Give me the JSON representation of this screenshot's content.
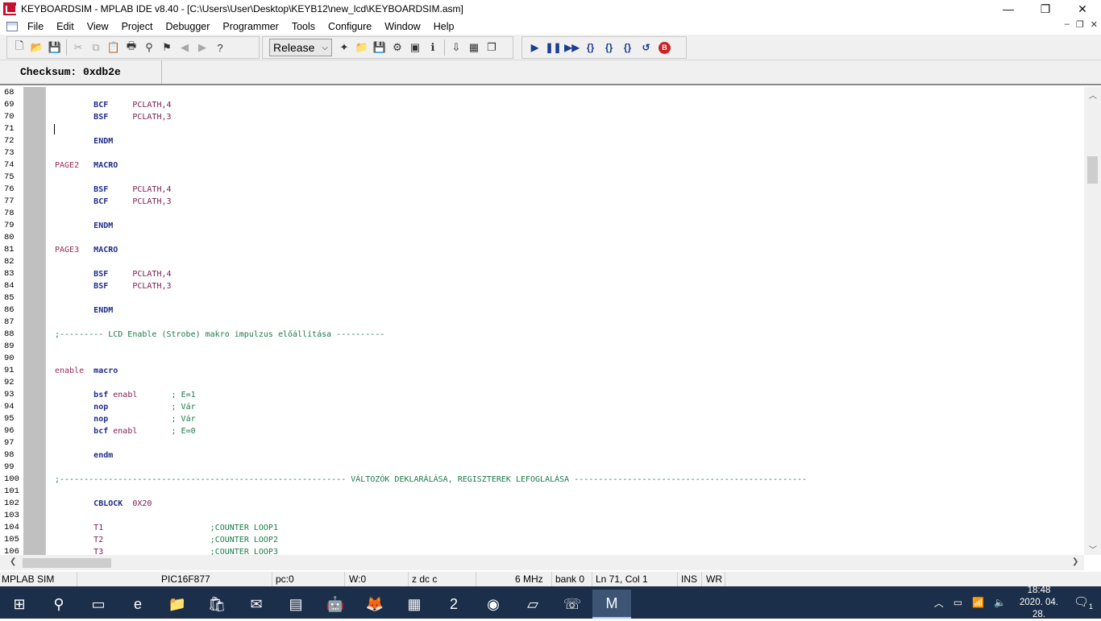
{
  "window": {
    "title": "KEYBOARDSIM - MPLAB IDE v8.40 - [C:\\Users\\User\\Desktop\\KEYB12\\new_lcd\\KEYBOARDSIM.asm]",
    "minimize": "—",
    "maximize": "❐",
    "close": "✕"
  },
  "menu": [
    "File",
    "Edit",
    "View",
    "Project",
    "Debugger",
    "Programmer",
    "Tools",
    "Configure",
    "Window",
    "Help"
  ],
  "mdi": {
    "minimize": "–",
    "restore": "❐",
    "close": "✕"
  },
  "toolbar": {
    "build_config": "Release",
    "file_buttons": [
      {
        "name": "new-file-icon",
        "glyph": "🗋"
      },
      {
        "name": "open-file-icon",
        "glyph": "📂"
      },
      {
        "name": "save-icon",
        "glyph": "💾"
      }
    ],
    "edit_buttons": [
      {
        "name": "cut-icon",
        "glyph": "✂",
        "dim": true
      },
      {
        "name": "copy-icon",
        "glyph": "⧉",
        "dim": true
      },
      {
        "name": "paste-icon",
        "glyph": "📋"
      },
      {
        "name": "print-icon",
        "glyph": "🖶"
      },
      {
        "name": "find-icon",
        "glyph": "⚲"
      },
      {
        "name": "find-in-files-icon",
        "glyph": "⚑"
      },
      {
        "name": "bookmark-prev-icon",
        "glyph": "◀",
        "dim": true
      },
      {
        "name": "bookmark-next-icon",
        "glyph": "▶",
        "dim": true
      },
      {
        "name": "help-icon",
        "glyph": "?"
      }
    ],
    "project_buttons": [
      {
        "name": "new-project-icon",
        "glyph": "✦"
      },
      {
        "name": "open-project-icon",
        "glyph": "📁"
      },
      {
        "name": "save-project-icon",
        "glyph": "💾"
      },
      {
        "name": "build-icon",
        "glyph": "⚙"
      },
      {
        "name": "make-icon",
        "glyph": "▣"
      },
      {
        "name": "info-icon",
        "glyph": "ℹ"
      }
    ],
    "program_buttons": [
      {
        "name": "import-icon",
        "glyph": "⇩"
      },
      {
        "name": "memory-icon",
        "glyph": "▦"
      },
      {
        "name": "windows-icon",
        "glyph": "❐"
      }
    ],
    "debug_buttons": [
      {
        "name": "run-icon",
        "glyph": "▶"
      },
      {
        "name": "halt-icon",
        "glyph": "❚❚"
      },
      {
        "name": "animate-icon",
        "glyph": "▶▶"
      },
      {
        "name": "step-into-icon",
        "glyph": "{}"
      },
      {
        "name": "step-over-icon",
        "glyph": "{}"
      },
      {
        "name": "step-out-icon",
        "glyph": "{}"
      },
      {
        "name": "reset-icon",
        "glyph": "↺"
      },
      {
        "name": "breakpoints-icon",
        "glyph": "B"
      }
    ]
  },
  "checksum": "Checksum:  0xdb2e",
  "editor": {
    "lines": [
      {
        "n": "68",
        "segs": []
      },
      {
        "n": "69",
        "segs": [
          [
            "",
            "        "
          ],
          [
            "kw",
            "BCF"
          ],
          [
            "",
            "     "
          ],
          [
            "opd",
            "PCLATH,4"
          ]
        ]
      },
      {
        "n": "70",
        "segs": [
          [
            "",
            "        "
          ],
          [
            "kw",
            "BSF"
          ],
          [
            "",
            "     "
          ],
          [
            "opd",
            "PCLATH,3"
          ]
        ]
      },
      {
        "n": "71",
        "segs": [],
        "caret": true
      },
      {
        "n": "72",
        "segs": [
          [
            "",
            "        "
          ],
          [
            "kw",
            "ENDM"
          ]
        ]
      },
      {
        "n": "73",
        "segs": []
      },
      {
        "n": "74",
        "segs": [
          [
            "lbl",
            "PAGE2"
          ],
          [
            "",
            "   "
          ],
          [
            "kw",
            "MACRO"
          ]
        ]
      },
      {
        "n": "75",
        "segs": []
      },
      {
        "n": "76",
        "segs": [
          [
            "",
            "        "
          ],
          [
            "kw",
            "BSF"
          ],
          [
            "",
            "     "
          ],
          [
            "opd",
            "PCLATH,4"
          ]
        ]
      },
      {
        "n": "77",
        "segs": [
          [
            "",
            "        "
          ],
          [
            "kw",
            "BCF"
          ],
          [
            "",
            "     "
          ],
          [
            "opd",
            "PCLATH,3"
          ]
        ]
      },
      {
        "n": "78",
        "segs": []
      },
      {
        "n": "79",
        "segs": [
          [
            "",
            "        "
          ],
          [
            "kw",
            "ENDM"
          ]
        ]
      },
      {
        "n": "80",
        "segs": []
      },
      {
        "n": "81",
        "segs": [
          [
            "lbl",
            "PAGE3"
          ],
          [
            "",
            "   "
          ],
          [
            "kw",
            "MACRO"
          ]
        ]
      },
      {
        "n": "82",
        "segs": []
      },
      {
        "n": "83",
        "segs": [
          [
            "",
            "        "
          ],
          [
            "kw",
            "BSF"
          ],
          [
            "",
            "     "
          ],
          [
            "opd",
            "PCLATH,4"
          ]
        ]
      },
      {
        "n": "84",
        "segs": [
          [
            "",
            "        "
          ],
          [
            "kw",
            "BSF"
          ],
          [
            "",
            "     "
          ],
          [
            "opd",
            "PCLATH,3"
          ]
        ]
      },
      {
        "n": "85",
        "segs": []
      },
      {
        "n": "86",
        "segs": [
          [
            "",
            "        "
          ],
          [
            "kw",
            "ENDM"
          ]
        ]
      },
      {
        "n": "87",
        "segs": []
      },
      {
        "n": "88",
        "segs": [
          [
            "cmt",
            ";--------- LCD Enable (Strobe) makro impulzus előállítása ----------"
          ]
        ]
      },
      {
        "n": "89",
        "segs": []
      },
      {
        "n": "90",
        "segs": []
      },
      {
        "n": "91",
        "segs": [
          [
            "lbl",
            "enable"
          ],
          [
            "",
            "  "
          ],
          [
            "kw",
            "macro"
          ]
        ]
      },
      {
        "n": "92",
        "segs": []
      },
      {
        "n": "93",
        "segs": [
          [
            "",
            "        "
          ],
          [
            "kw",
            "bsf"
          ],
          [
            "",
            " "
          ],
          [
            "opd",
            "enabl"
          ],
          [
            "",
            "       "
          ],
          [
            "cmt",
            "; E=1"
          ]
        ]
      },
      {
        "n": "94",
        "segs": [
          [
            "",
            "        "
          ],
          [
            "kw",
            "nop"
          ],
          [
            "",
            "             "
          ],
          [
            "cmt",
            "; Vár"
          ]
        ]
      },
      {
        "n": "95",
        "segs": [
          [
            "",
            "        "
          ],
          [
            "kw",
            "nop"
          ],
          [
            "",
            "             "
          ],
          [
            "cmt",
            "; Vár"
          ]
        ]
      },
      {
        "n": "96",
        "segs": [
          [
            "",
            "        "
          ],
          [
            "kw",
            "bcf"
          ],
          [
            "",
            " "
          ],
          [
            "opd",
            "enabl"
          ],
          [
            "",
            "       "
          ],
          [
            "cmt",
            "; E=0"
          ]
        ]
      },
      {
        "n": "97",
        "segs": []
      },
      {
        "n": "98",
        "segs": [
          [
            "",
            "        "
          ],
          [
            "kw",
            "endm"
          ]
        ]
      },
      {
        "n": "99",
        "segs": []
      },
      {
        "n": "100",
        "segs": [
          [
            "cmt",
            ";----------------------------------------------------------- VÁLTOZÓK DEKLARÁLÁSA, REGISZTEREK LEFOGLALÁSA ------------------------------------------------"
          ]
        ]
      },
      {
        "n": "101",
        "segs": []
      },
      {
        "n": "102",
        "segs": [
          [
            "",
            "        "
          ],
          [
            "kw",
            "CBLOCK"
          ],
          [
            "",
            "  "
          ],
          [
            "opd",
            "0X20"
          ]
        ]
      },
      {
        "n": "103",
        "segs": []
      },
      {
        "n": "104",
        "segs": [
          [
            "",
            "        "
          ],
          [
            "opd",
            "T1"
          ],
          [
            "",
            "                      "
          ],
          [
            "cmt",
            ";COUNTER LOOP1"
          ]
        ]
      },
      {
        "n": "105",
        "segs": [
          [
            "",
            "        "
          ],
          [
            "opd",
            "T2"
          ],
          [
            "",
            "                      "
          ],
          [
            "cmt",
            ";COUNTER LOOP2"
          ]
        ]
      },
      {
        "n": "106",
        "segs": [
          [
            "",
            "        "
          ],
          [
            "opd",
            "T3"
          ],
          [
            "",
            "                      "
          ],
          [
            "cmt",
            ";COUNTER LOOP3"
          ]
        ]
      }
    ]
  },
  "status": {
    "debugger": "MPLAB SIM",
    "device": "PIC16F877",
    "pc": "pc:0",
    "w": "W:0",
    "flags": "z dc c",
    "freq": "6 MHz",
    "bank": "bank 0",
    "position": "Ln 71, Col 1",
    "ins": "INS",
    "wr": "WR"
  },
  "taskbar": {
    "apps": [
      {
        "name": "start-icon",
        "glyph": "⊞"
      },
      {
        "name": "search-icon",
        "glyph": "⚲"
      },
      {
        "name": "task-view-icon",
        "glyph": "▭"
      },
      {
        "name": "edge-icon",
        "glyph": "e"
      },
      {
        "name": "file-explorer-icon",
        "glyph": "📁"
      },
      {
        "name": "store-icon",
        "glyph": "🛍"
      },
      {
        "name": "mail-icon",
        "glyph": "✉"
      },
      {
        "name": "control-panel-icon",
        "glyph": "▤"
      },
      {
        "name": "android-icon",
        "glyph": "🤖"
      },
      {
        "name": "firefox-icon",
        "glyph": "🦊"
      },
      {
        "name": "calculator-icon",
        "glyph": "▦"
      },
      {
        "name": "pickit2-icon",
        "glyph": "2"
      },
      {
        "name": "chrome-icon",
        "glyph": "◉"
      },
      {
        "name": "notepad-icon",
        "glyph": "▱"
      },
      {
        "name": "viber-icon",
        "glyph": "☏"
      },
      {
        "name": "mplab-icon",
        "glyph": "M",
        "active": true
      }
    ],
    "tray": {
      "time": "18:48",
      "date": "2020. 04. 28.",
      "notifications": "1"
    }
  }
}
